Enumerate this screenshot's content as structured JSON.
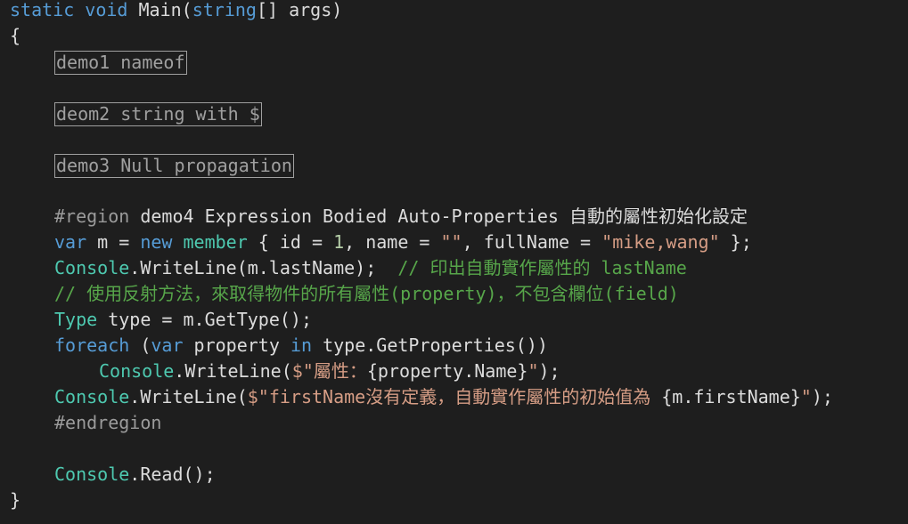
{
  "code": {
    "signature": {
      "kw_static": "static",
      "kw_void": "void",
      "name": " Main(",
      "kw_string": "string",
      "rest": "[] args)"
    },
    "open_brace": "{",
    "close_brace": "}",
    "regions": [
      {
        "label": "demo1 nameof"
      },
      {
        "label": "deom2 string with $"
      },
      {
        "label": "demo3 Null propagation"
      }
    ],
    "region4": {
      "directive": "#region",
      "title": " demo4 Expression Bodied Auto-Properties 自動的屬性初始化設定",
      "endregion": "#endregion"
    },
    "line_var": {
      "kw_var": "var",
      "t1": " m = ",
      "kw_new": "new",
      "t2": " ",
      "type": "member",
      "t3": " { id = ",
      "num": "1",
      "t4": ", name = ",
      "str1": "\"\"",
      "t5": ", fullName = ",
      "str2": "\"mike,wang\"",
      "t6": " };"
    },
    "line_print_last": {
      "type": "Console",
      "t1": ".WriteLine(m.lastName);  ",
      "comment": "// 印出自動實作屬性的 lastName"
    },
    "line_comment": "// 使用反射方法，來取得物件的所有屬性(property)，不包含欄位(field)",
    "line_type": {
      "type": "Type",
      "t1": " type = m.GetType();"
    },
    "line_foreach": {
      "kw_foreach": "foreach",
      "t1": " (",
      "kw_var": "var",
      "t2": " property ",
      "kw_in": "in",
      "t3": " type.GetProperties())"
    },
    "line_print_prop": {
      "type": "Console",
      "t1": ".WriteLine(",
      "str_open": "$\"屬性：",
      "t2": "{property.Name}",
      "str_close": "\"",
      "t3": ");"
    },
    "line_print_first": {
      "type": "Console",
      "t1": ".WriteLine(",
      "str_open": "$\"firstName沒有定義，自動實作屬性的初始值為 ",
      "t2": "{m.firstName}",
      "str_close": "\"",
      "t3": ");"
    },
    "line_read": {
      "type": "Console",
      "t1": ".Read();"
    }
  },
  "colors": {
    "background": "#1e1e1e",
    "keyword": "#569cd6",
    "type": "#4ec9b0",
    "string": "#d69d85",
    "number": "#b5cea8",
    "comment": "#57a64a",
    "preprocessor": "#9b9b9b",
    "text": "#dcdcdc"
  }
}
